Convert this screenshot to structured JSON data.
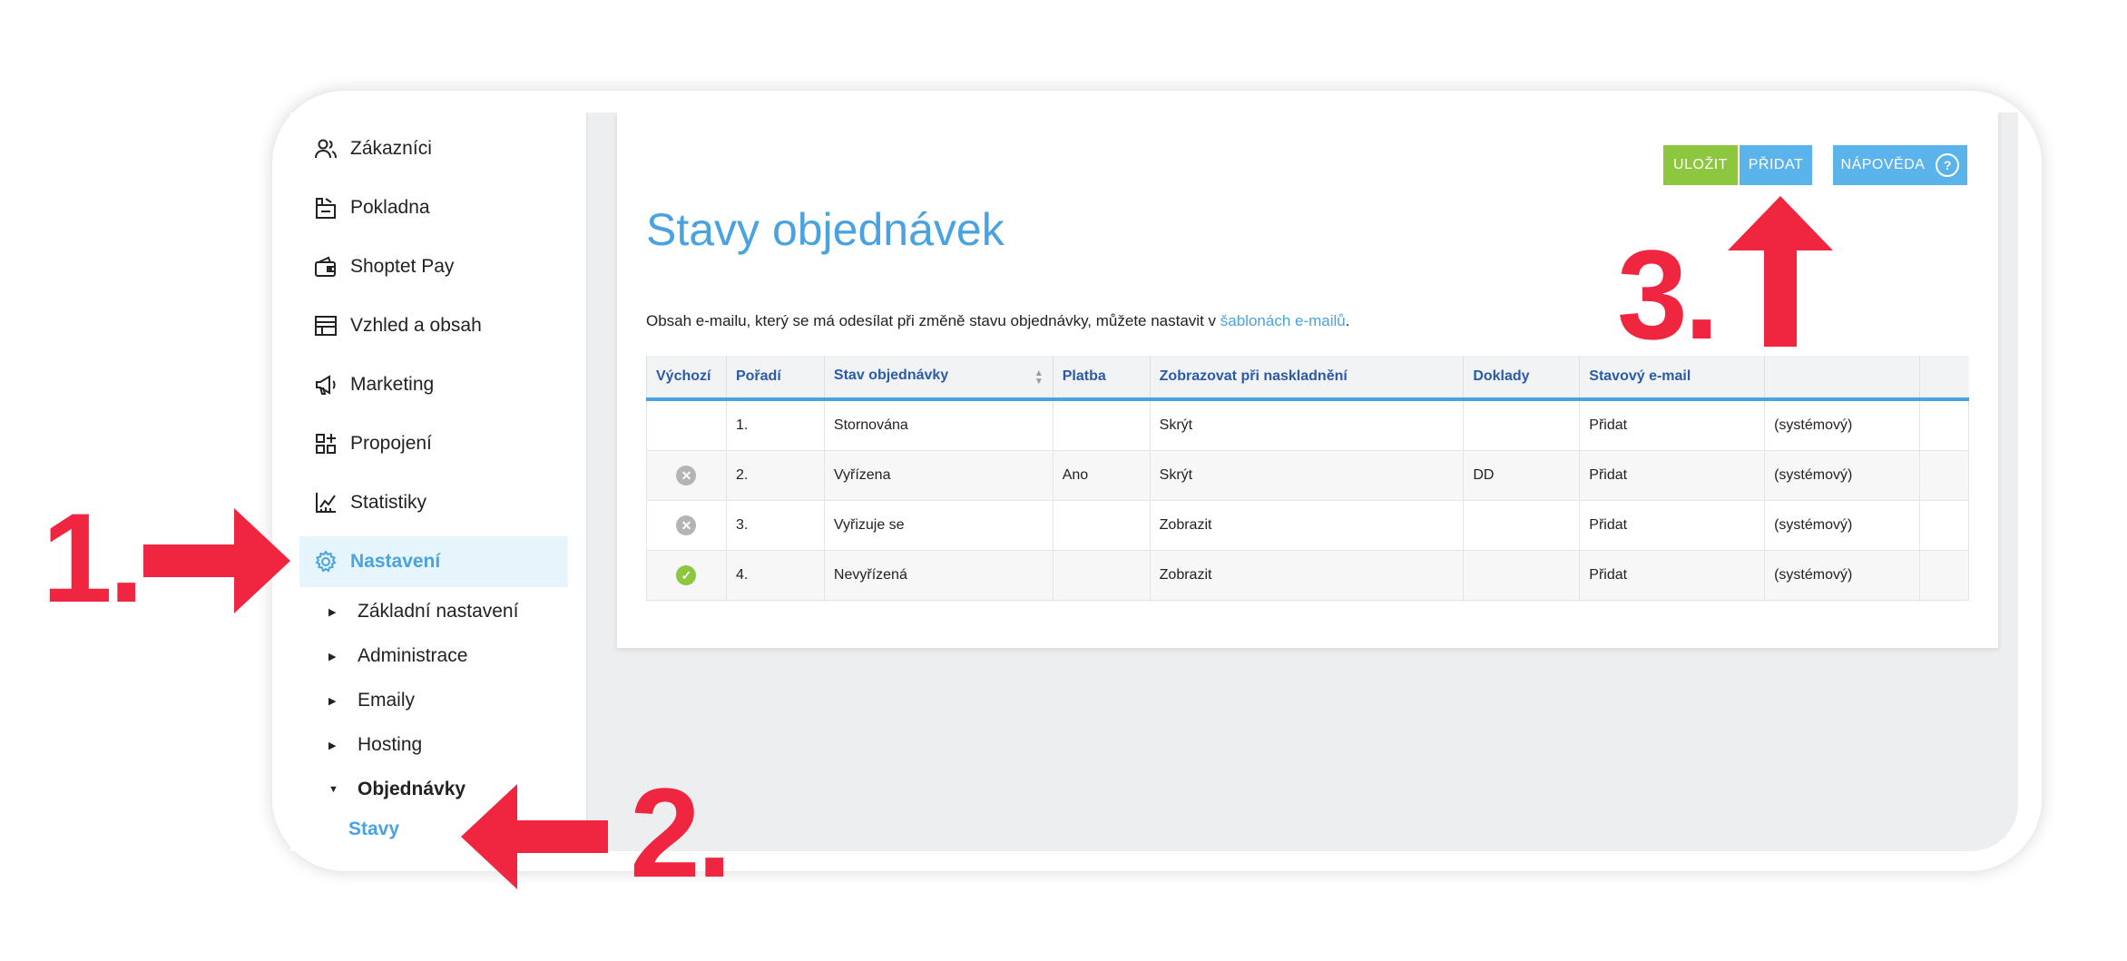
{
  "sidebar": {
    "items": [
      {
        "label": "Zákazníci",
        "icon": "users-icon"
      },
      {
        "label": "Pokladna",
        "icon": "register-icon"
      },
      {
        "label": "Shoptet Pay",
        "icon": "wallet-icon"
      },
      {
        "label": "Vzhled a obsah",
        "icon": "layout-icon"
      },
      {
        "label": "Marketing",
        "icon": "megaphone-icon"
      },
      {
        "label": "Propojení",
        "icon": "apps-icon"
      },
      {
        "label": "Statistiky",
        "icon": "chart-icon"
      },
      {
        "label": "Nastavení",
        "icon": "gear-icon",
        "active": true
      }
    ],
    "subitems": [
      {
        "label": "Základní nastavení"
      },
      {
        "label": "Administrace"
      },
      {
        "label": "Emaily"
      },
      {
        "label": "Hosting"
      },
      {
        "label": "Objednávky",
        "open": true
      }
    ],
    "active_leaf": "Stavy"
  },
  "toolbar": {
    "save_label": "ULOŽIT",
    "add_label": "PŘIDAT",
    "help_label": "NÁPOVĚDA",
    "help_icon": "?"
  },
  "page": {
    "title": "Stavy objednávek",
    "info_text": "Obsah e-mailu, který se má odesílat při změně stavu objednávky, můžete nastavit v ",
    "info_link": "šablonách e-mailů",
    "info_end": "."
  },
  "table": {
    "headers": [
      "Výchozí",
      "Pořadí",
      "Stav objednávky",
      "Platba",
      "Zobrazovat při naskladnění",
      "Doklady",
      "Stavový e-mail",
      "",
      ""
    ],
    "rows": [
      {
        "default_icon": "none",
        "order": "1.",
        "state": "Stornována",
        "state_color": "#888888",
        "payment": "",
        "display": "Skrýt",
        "docs": "",
        "email": "Přidat",
        "system": "(systémový)"
      },
      {
        "default_icon": "x-circle-icon",
        "order": "2.",
        "state": "Vyřízena",
        "state_color": "#5aa02c",
        "payment": "Ano",
        "display": "Skrýt",
        "docs": "DD",
        "email": "Přidat",
        "system": "(systémový)"
      },
      {
        "default_icon": "x-circle-icon",
        "order": "3.",
        "state": "Vyřizuje se",
        "state_color": "#2b6ed4",
        "payment": "",
        "display": "Zobrazit",
        "docs": "",
        "email": "Přidat",
        "system": "(systémový)"
      },
      {
        "default_icon": "check-circle-icon",
        "order": "4.",
        "state": "Nevyřízená",
        "state_color": "#2b6ed4",
        "payment": "",
        "display": "Zobrazit",
        "docs": "",
        "email": "Přidat",
        "system": "(systémový)"
      }
    ]
  },
  "annotations": {
    "step1": "1.",
    "step2": "2.",
    "step3": "3.",
    "color": "#f02640"
  }
}
